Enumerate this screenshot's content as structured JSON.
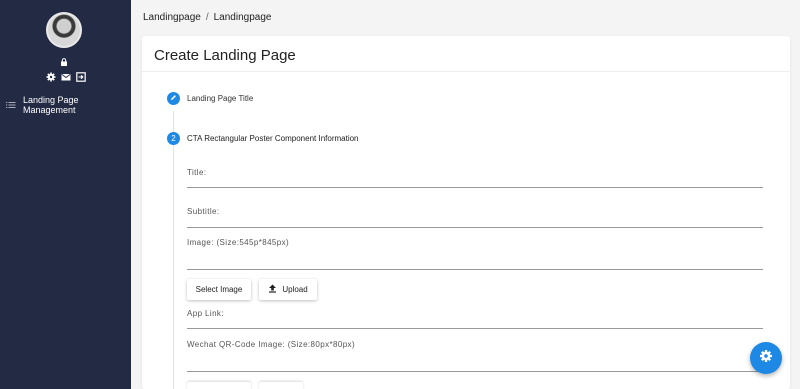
{
  "sidebar": {
    "menu_items": [
      {
        "label": "Landing Page Management",
        "icon": "list-icon"
      }
    ]
  },
  "breadcrumb": {
    "items": [
      "Landingpage",
      "Landingpage"
    ],
    "separator": "/"
  },
  "card": {
    "title": "Create Landing Page"
  },
  "steps": [
    {
      "badge": "",
      "label": "Landing Page Title",
      "icon": "pencil-icon"
    },
    {
      "badge": "2",
      "label": "CTA Rectangular Poster Component Information"
    }
  ],
  "form": {
    "title_label": "Title:",
    "subtitle_label": "Subtitle:",
    "image_label": "Image: (Size:545p*845px)",
    "select_image_label": "Select Image",
    "upload_label": "Upload",
    "app_link_label": "App Link:",
    "qr_label": "Wechat QR-Code Image: (Size:80px*80px)"
  },
  "colors": {
    "sidebar_bg": "#232a44",
    "accent": "#1e88e5"
  }
}
